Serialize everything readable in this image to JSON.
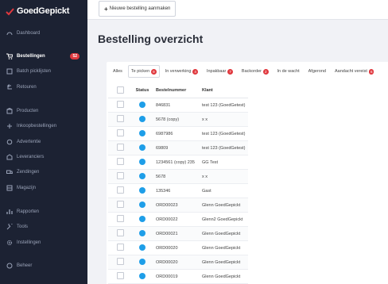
{
  "brand": {
    "name": "GoedGepickt",
    "accent": "#e0383e"
  },
  "sidebar": {
    "items": [
      {
        "label": "Dashboard",
        "icon": "dashboard-icon"
      },
      {
        "label": "Bestellingen",
        "icon": "cart-icon",
        "badge": "52",
        "active": true
      },
      {
        "label": "Batch picklijsten",
        "icon": "batch-icon"
      },
      {
        "label": "Retouren",
        "icon": "return-icon"
      },
      {
        "label": "Producten",
        "icon": "box-icon"
      },
      {
        "label": "Inkoopbestellingen",
        "icon": "purchase-icon"
      },
      {
        "label": "Advertentie",
        "icon": "sync-icon"
      },
      {
        "label": "Leveranciers",
        "icon": "supplier-icon"
      },
      {
        "label": "Zendingen",
        "icon": "truck-icon"
      },
      {
        "label": "Magazijn",
        "icon": "warehouse-icon"
      },
      {
        "label": "Rapporten",
        "icon": "chart-icon"
      },
      {
        "label": "Tools",
        "icon": "wrench-icon"
      },
      {
        "label": "Instellingen",
        "icon": "gear-icon"
      },
      {
        "label": "Beheer",
        "icon": "admin-icon"
      }
    ]
  },
  "toolbar": {
    "new_order_label": "Nieuwe bestelling aanmaken"
  },
  "page": {
    "title": "Bestelling overzicht"
  },
  "tabs": [
    {
      "label": "Alles",
      "count": ""
    },
    {
      "label": "Te picken",
      "count": "9"
    },
    {
      "label": "In verwerking",
      "count": "4"
    },
    {
      "label": "Inpakbaar",
      "count": "7"
    },
    {
      "label": "Backorder",
      "count": "2"
    },
    {
      "label": "In de wacht",
      "count": ""
    },
    {
      "label": "Afgerond",
      "count": ""
    },
    {
      "label": "Aandacht vereist",
      "count": "6"
    }
  ],
  "table": {
    "headers": {
      "status": "Status",
      "number": "Bestelnummer",
      "client": "Klant"
    },
    "rows": [
      {
        "number": "846831",
        "client": "test 123 (GoedGetest)"
      },
      {
        "number": "5678 (copy)",
        "client": "x x"
      },
      {
        "number": "6987986",
        "client": "test 123 (GoedGetest)"
      },
      {
        "number": "69809",
        "client": "test 123 (GoedGetest)"
      },
      {
        "number": "1234561 (copy) 235",
        "client": "GG Test"
      },
      {
        "number": "5678",
        "client": "x x"
      },
      {
        "number": "135346",
        "client": "Gast"
      },
      {
        "number": "ORD00023",
        "client": "Glenn GoedGepickt"
      },
      {
        "number": "ORD00022",
        "client": "Glenn2 GoedGepickt"
      },
      {
        "number": "ORD00021",
        "client": "Glenn GoedGepickt"
      },
      {
        "number": "ORD00020",
        "client": "Glenn GoedGepickt"
      },
      {
        "number": "ORD00020",
        "client": "Glenn GoedGepickt"
      },
      {
        "number": "ORD00019",
        "client": "Glenn GoedGepickt"
      }
    ]
  }
}
